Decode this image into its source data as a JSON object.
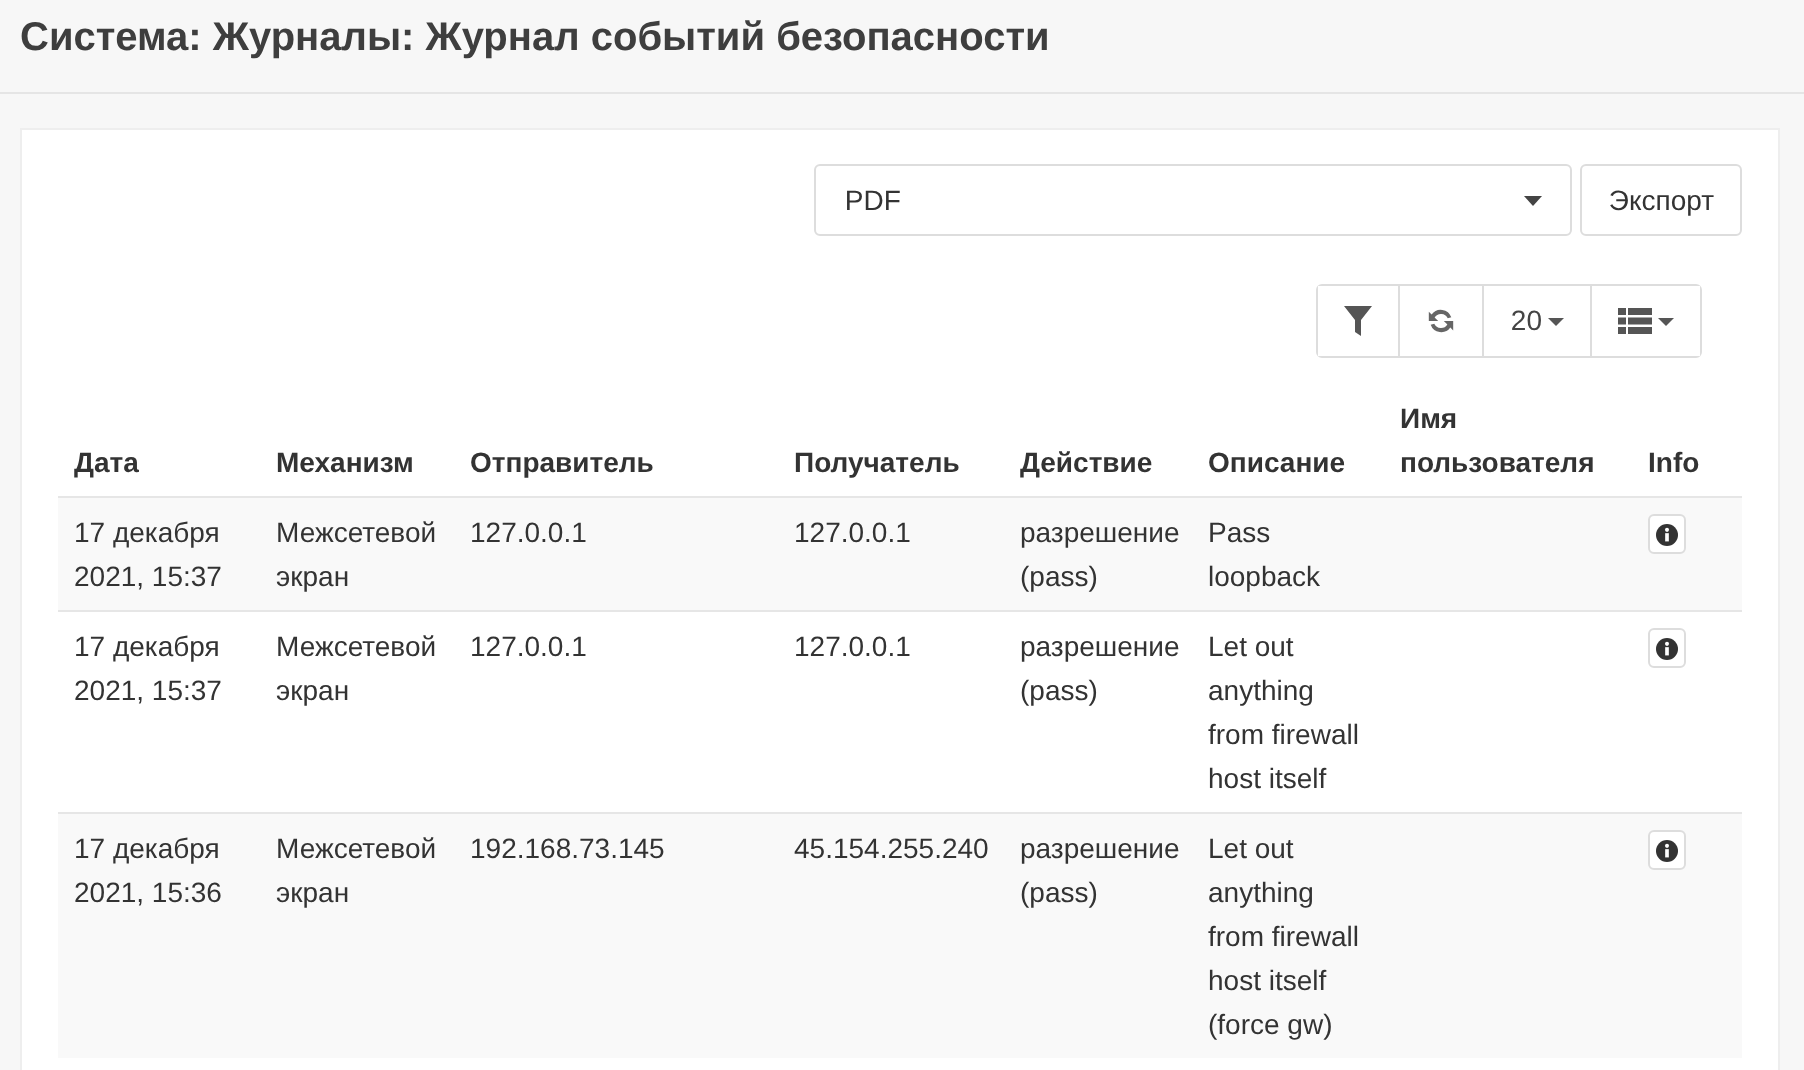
{
  "page_title": "Система: Журналы: Журнал событий безопасности",
  "export": {
    "format": "PDF",
    "button": "Экспорт"
  },
  "toolbar": {
    "page_size": "20"
  },
  "table": {
    "columns": [
      "Дата",
      "Механизм",
      "Отправитель",
      "Получатель",
      "Действие",
      "Описание",
      "Имя пользователя",
      "Info"
    ],
    "rows": [
      {
        "date": "17 декабря 2021, 15:37",
        "mechanism": "Межсетевой экран",
        "source": "127.0.0.1",
        "destination": "127.0.0.1",
        "action": "разрешение (pass)",
        "description": "Pass loopback"
      },
      {
        "date": "17 декабря 2021, 15:37",
        "mechanism": "Межсетевой экран",
        "source": "127.0.0.1",
        "destination": "127.0.0.1",
        "action": "разрешение (pass)",
        "description": "Let out anything from firewall host itself"
      },
      {
        "date": "17 декабря 2021, 15:36",
        "mechanism": "Межсетевой экран",
        "source": "192.168.73.145",
        "destination": "45.154.255.240",
        "action": "разрешение (pass)",
        "description": "Let out anything from firewall host itself (force gw)"
      }
    ]
  }
}
